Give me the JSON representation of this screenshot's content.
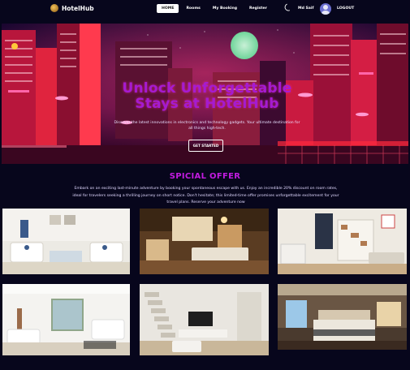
{
  "nav": {
    "brand": "HotelHub",
    "links": [
      "HOME",
      "Rooms",
      "My Booking",
      "Register"
    ],
    "user": "Md Saif",
    "logout": "LOGOUT"
  },
  "hero": {
    "title_line1": "Unlock Unforgettable",
    "title_line2": "Stays at HotelHub",
    "subtitle": "Discover the latest innovations in electronics and technology gadgets. Your ultimate destination for all things high-tech.",
    "cta": "GET STARTED"
  },
  "offer": {
    "title": "SPICIAL OFFER",
    "text": "Embark on an exciting last-minute adventure by booking your spontaneous escape with us. Enjoy an incredible 20% discount on room rates, ideal for travelers seeking a thrilling journey on short notice. Don't hesitate; this limited-time offer promises unforgettable excitement for your travel plans. Reserve your adventure now"
  },
  "colors": {
    "background": "#07061c",
    "accent_purple": "#c21be0",
    "neon_red": "#ff2a3c"
  },
  "gallery": [
    {
      "name": "white-living-room"
    },
    {
      "name": "wood-lounge-room"
    },
    {
      "name": "bookshelf-living-room"
    },
    {
      "name": "bright-living-room"
    },
    {
      "name": "staircase-room"
    },
    {
      "name": "hotel-bedroom"
    }
  ]
}
